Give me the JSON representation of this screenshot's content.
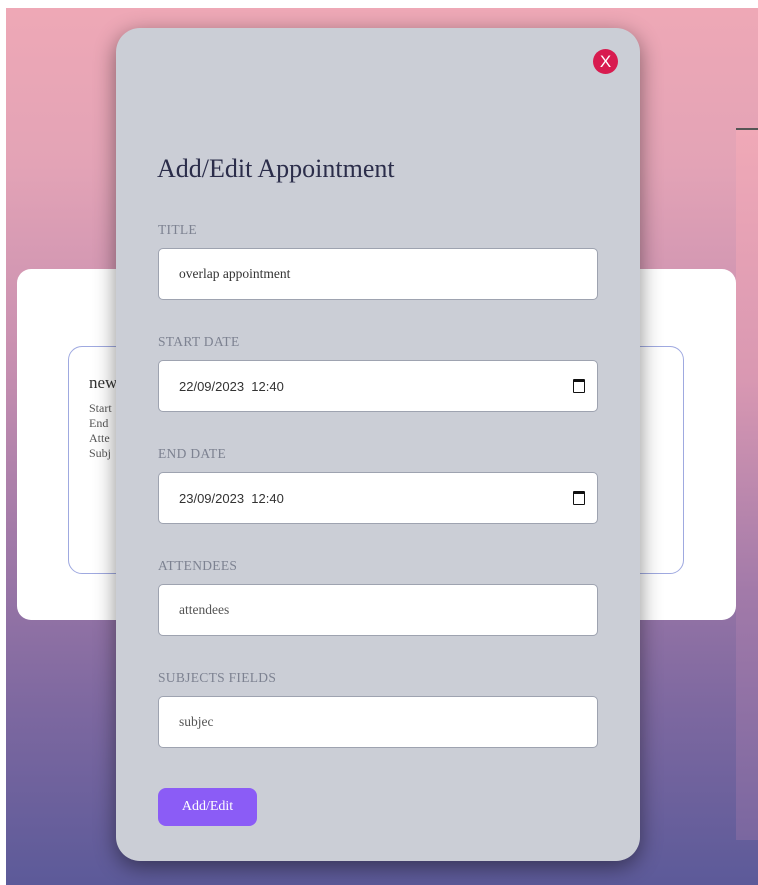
{
  "background": {
    "appointment_title": "new",
    "lines": [
      "Start",
      "End",
      "Atte",
      "Subj"
    ]
  },
  "modal": {
    "close_label": "X",
    "title": "Add/Edit Appointment",
    "fields": {
      "title": {
        "label": "TITLE",
        "value": "overlap appointment"
      },
      "start_date": {
        "label": "START DATE",
        "value": "22/09/2023  12:40"
      },
      "end_date": {
        "label": "END DATE",
        "value": "23/09/2023  12:40"
      },
      "attendees": {
        "label": "ATTENDEES",
        "value": "attendees"
      },
      "subjects": {
        "label": "SUBJECTS FIELDS",
        "value": "subjec"
      }
    },
    "submit_label": "Add/Edit"
  },
  "colors": {
    "accent": "#8b5cf6",
    "close": "#d81b4f",
    "modal_bg": "#cbced6",
    "card_border": "#9fa9e0"
  },
  "icons": {
    "close": "close-icon",
    "calendar": "calendar-icon"
  }
}
